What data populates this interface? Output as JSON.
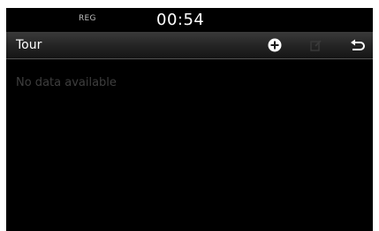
{
  "status_bar": {
    "mode_label": "REG",
    "time": "00:54"
  },
  "header": {
    "title": "Tour",
    "buttons": {
      "add_icon": "plus-circle-icon",
      "edit_icon": "edit-icon",
      "edit_disabled": true,
      "back_icon": "back-arrow-icon"
    }
  },
  "main": {
    "empty_message": "No data available"
  },
  "colors": {
    "background": "#000000",
    "text_primary": "#ffffff",
    "text_muted": "#3e3e3e",
    "icon_disabled": "#3a3a3a"
  }
}
